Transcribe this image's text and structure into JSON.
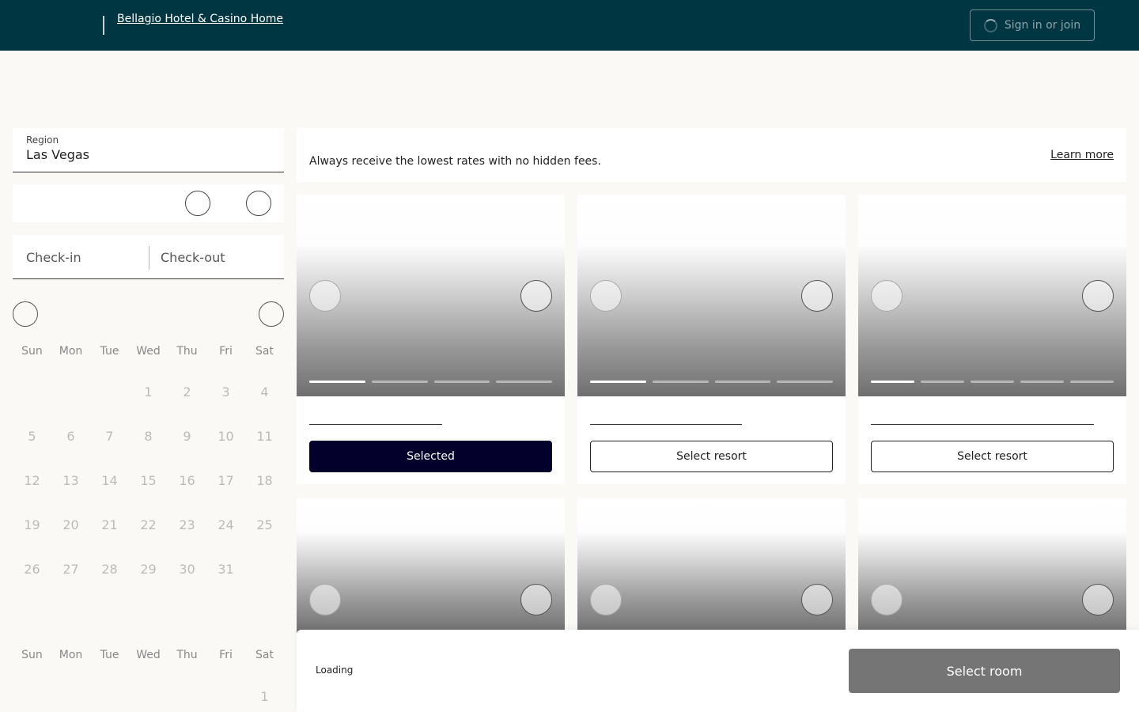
{
  "header": {
    "logo_alt": "Bellagio Hotel & Casino Home",
    "signin_label": "Sign in or join"
  },
  "search": {
    "region_label": "Region",
    "region_value": "Las Vegas",
    "checkin_placeholder": "Check-in",
    "checkout_placeholder": "Check-out"
  },
  "calendar": {
    "weekdays": [
      "Sun",
      "Mon",
      "Tue",
      "Wed",
      "Thu",
      "Fri",
      "Sat"
    ],
    "month1_days": [
      "",
      "",
      "",
      "1",
      "2",
      "3",
      "4",
      "5",
      "6",
      "7",
      "8",
      "9",
      "10",
      "11",
      "12",
      "13",
      "14",
      "15",
      "16",
      "17",
      "18",
      "19",
      "20",
      "21",
      "22",
      "23",
      "24",
      "25",
      "26",
      "27",
      "28",
      "29",
      "30",
      "31"
    ],
    "month2_days": [
      "",
      "",
      "",
      "",
      "",
      "",
      "1"
    ]
  },
  "banner": {
    "text": "Always receive the lowest rates with no hidden fees.",
    "learn_more": "Learn more"
  },
  "cards": [
    {
      "button_label": "Selected",
      "selected": true,
      "image_count": 4
    },
    {
      "button_label": "Select resort",
      "selected": false,
      "image_count": 4
    },
    {
      "button_label": "Select resort",
      "selected": false,
      "image_count": 5
    }
  ],
  "bottom_bar": {
    "status": "Loading",
    "select_room_label": "Select room"
  },
  "colors": {
    "header_bg": "#003542",
    "selected_button": "#03002c",
    "select_room_disabled": "#757575",
    "page_bg": "#faf9f6"
  }
}
